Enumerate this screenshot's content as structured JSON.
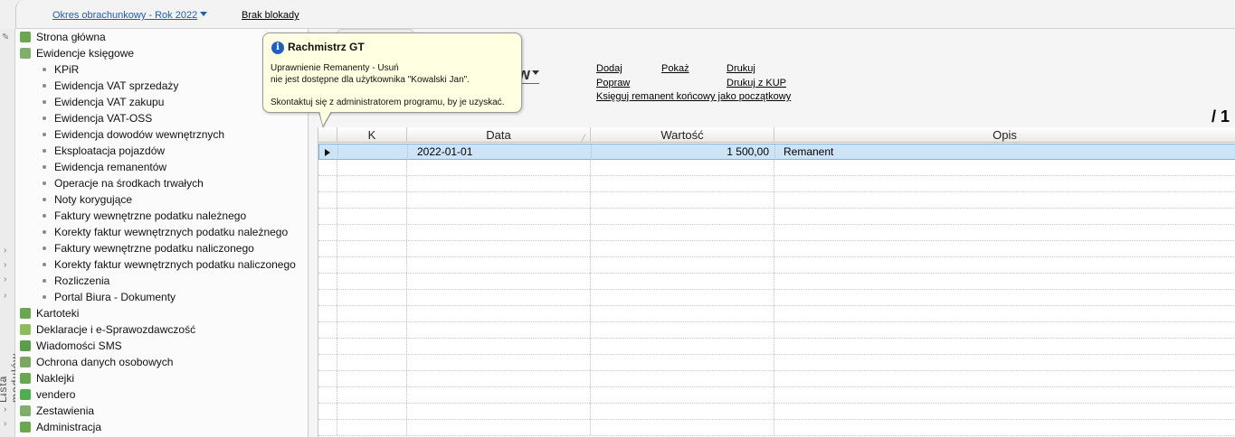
{
  "topbar": {
    "period_label": "Okres obrachunkowy - Rok 2022",
    "lock_label": "Brak blokady"
  },
  "side": {
    "vertical_label": "Lista modułów"
  },
  "nav": {
    "items_top": [
      {
        "label": "Strona główna",
        "icon": "home-icon",
        "color": "#6aa84f"
      },
      {
        "label": "Ewidencje księgowe",
        "icon": "ledger-icon",
        "color": "#7fb069"
      }
    ],
    "sub_items": [
      "KPiR",
      "Ewidencja VAT sprzedaży",
      "Ewidencja VAT zakupu",
      "Ewidencja VAT-OSS",
      "Ewidencja dowodów wewnętrznych",
      "Eksploatacja pojazdów",
      "Ewidencja remanentów",
      "Operacje na środkach trwałych",
      "Noty korygujące",
      "Faktury wewnętrzne podatku należnego",
      "Korekty faktur wewnętrznych podatku należnego",
      "Faktury wewnętrzne podatku naliczonego",
      "Korekty faktur wewnętrznych podatku naliczonego",
      "Rozliczenia",
      "Portal Biura - Dokumenty"
    ],
    "items_bottom": [
      {
        "label": "Kartoteki",
        "icon": "cards-icon",
        "color": "#6aa84f"
      },
      {
        "label": "Deklaracje i e-Sprawozdawczość",
        "icon": "declaration-icon",
        "color": "#8fbc5a"
      },
      {
        "label": "Wiadomości SMS",
        "icon": "sms-icon",
        "color": "#5a9e4a"
      },
      {
        "label": "Ochrona danych osobowych",
        "icon": "shield-icon",
        "color": "#7aa860"
      },
      {
        "label": "Naklejki",
        "icon": "sticker-icon",
        "color": "#6aa84f"
      },
      {
        "label": "vendero",
        "icon": "vendero-icon",
        "color": "#4caf50"
      },
      {
        "label": "Zestawienia",
        "icon": "report-icon",
        "color": "#7fb069"
      },
      {
        "label": "Administracja",
        "icon": "admin-icon",
        "color": "#6aa84f"
      }
    ]
  },
  "content": {
    "view_partial": "w",
    "actions": {
      "dodaj": "Dodaj",
      "pokaz": "Pokaż",
      "drukuj": "Drukuj",
      "popraw": "Popraw",
      "drukuj_kup": "Drukuj z KUP",
      "ksieguj": "Księguj remanent końcowy jako początkowy"
    },
    "pager": "/ 1"
  },
  "grid": {
    "columns": [
      "K",
      "Data",
      "Wartość",
      "Opis"
    ],
    "rows": [
      {
        "k": "",
        "data": "2022-01-01",
        "wartosc": "1 500,00",
        "opis": "Remanent"
      }
    ]
  },
  "tooltip": {
    "title": "Rachmistrz GT",
    "line1": "Uprawnienie Remanenty - Usuń",
    "line2": "nie jest dostępne dla użytkownika \"Kowalski Jan\".",
    "line3": "Skontaktuj się z administratorem programu, by je uzyskać."
  }
}
